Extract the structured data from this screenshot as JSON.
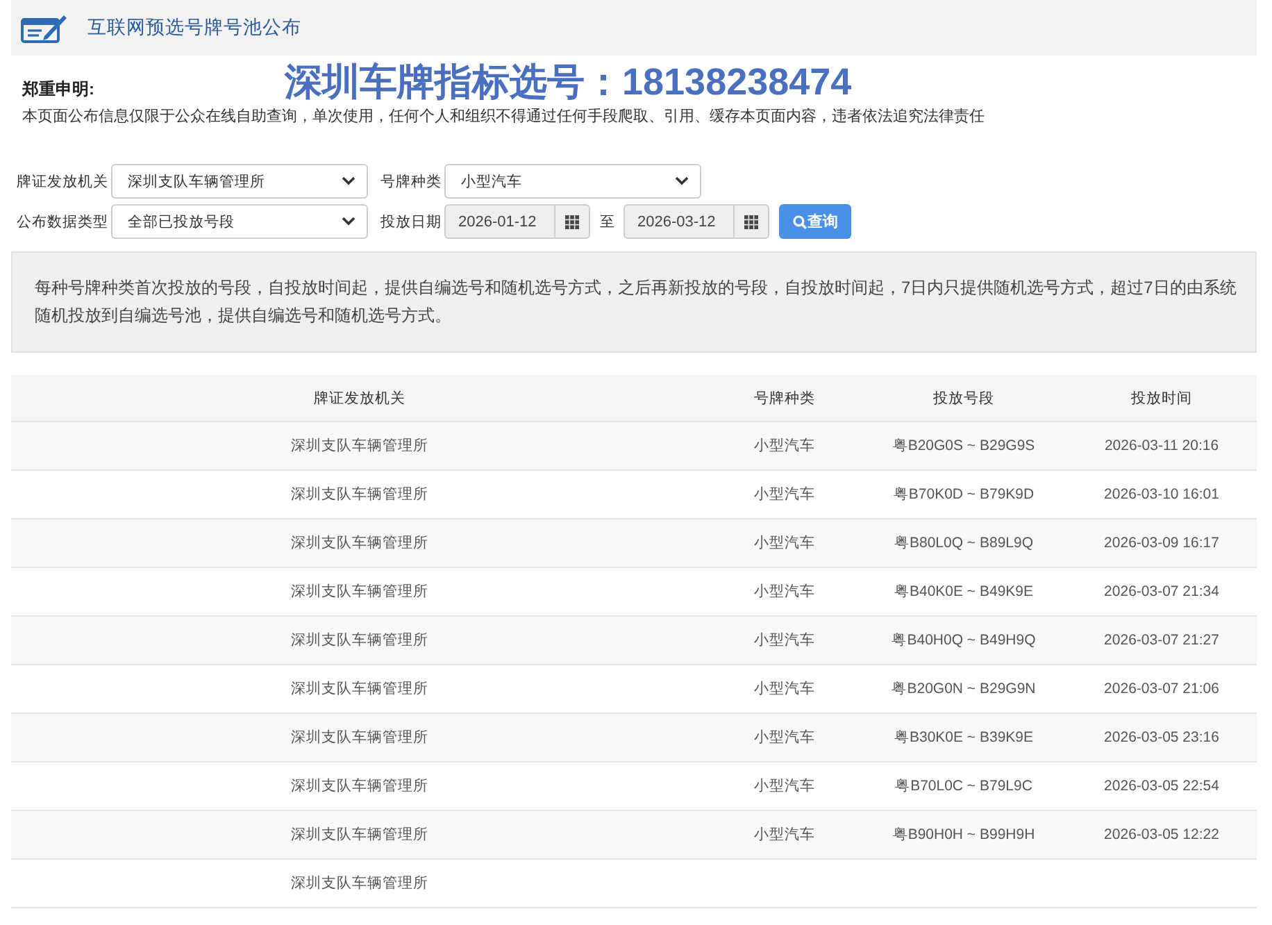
{
  "header": {
    "title": "互联网预选号牌号池公布"
  },
  "notice": {
    "heading": "郑重申明:",
    "banner": "深圳车牌指标选号：18138238474",
    "text": "本页面公布信息仅限于公众在线自助查询，单次使用，任何个人和组织不得通过任何手段爬取、引用、缓存本页面内容，违者依法追究法律责任"
  },
  "filter_rows": [
    [
      {
        "kind": "select",
        "label": "牌证发放机关",
        "value": "深圳支队车辆管理所"
      },
      {
        "kind": "select",
        "label": "号牌种类",
        "value": "小型汽车"
      }
    ],
    [
      {
        "kind": "select",
        "label": "公布数据类型",
        "value": "全部已投放号段"
      },
      {
        "kind": "date_range",
        "label": "投放日期",
        "from": "2026-01-12",
        "separator": "至",
        "to": "2026-03-12"
      },
      {
        "kind": "button",
        "label": "查询"
      }
    ]
  ],
  "info": "每种号牌种类首次投放的号段，自投放时间起，提供自编选号和随机选号方式，之后再新投放的号段，自投放时间起，7日内只提供随机选号方式，超过7日的由系统随机投放到自编选号池，提供自编选号和随机选号方式。",
  "table": {
    "columns": [
      "牌证发放机关",
      "号牌种类",
      "投放号段",
      "投放时间"
    ],
    "rows": [
      {
        "cells": [
          "深圳支队车辆管理所",
          "小型汽车",
          "粤B20G0S ~ B29G9S",
          "2026-03-11 20:16"
        ]
      },
      {
        "cells": [
          "深圳支队车辆管理所",
          "小型汽车",
          "粤B70K0D ~ B79K9D",
          "2026-03-10 16:01"
        ]
      },
      {
        "cells": [
          "深圳支队车辆管理所",
          "小型汽车",
          "粤B80L0Q ~ B89L9Q",
          "2026-03-09 16:17"
        ]
      },
      {
        "cells": [
          "深圳支队车辆管理所",
          "小型汽车",
          "粤B40K0E ~ B49K9E",
          "2026-03-07 21:34"
        ]
      },
      {
        "cells": [
          "深圳支队车辆管理所",
          "小型汽车",
          "粤B40H0Q ~ B49H9Q",
          "2026-03-07 21:27"
        ]
      },
      {
        "cells": [
          "深圳支队车辆管理所",
          "小型汽车",
          "粤B20G0N ~ B29G9N",
          "2026-03-07 21:06"
        ]
      },
      {
        "cells": [
          "深圳支队车辆管理所",
          "小型汽车",
          "粤B30K0E ~ B39K9E",
          "2026-03-05 23:16"
        ]
      },
      {
        "cells": [
          "深圳支队车辆管理所",
          "小型汽车",
          "粤B70L0C ~ B79L9C",
          "2026-03-05 22:54"
        ]
      },
      {
        "cells": [
          "深圳支队车辆管理所",
          "小型汽车",
          "粤B90H0H ~ B99H9H",
          "2026-03-05 12:22"
        ]
      },
      {
        "cells": [
          "深圳支队车辆管理所"
        ]
      }
    ]
  }
}
